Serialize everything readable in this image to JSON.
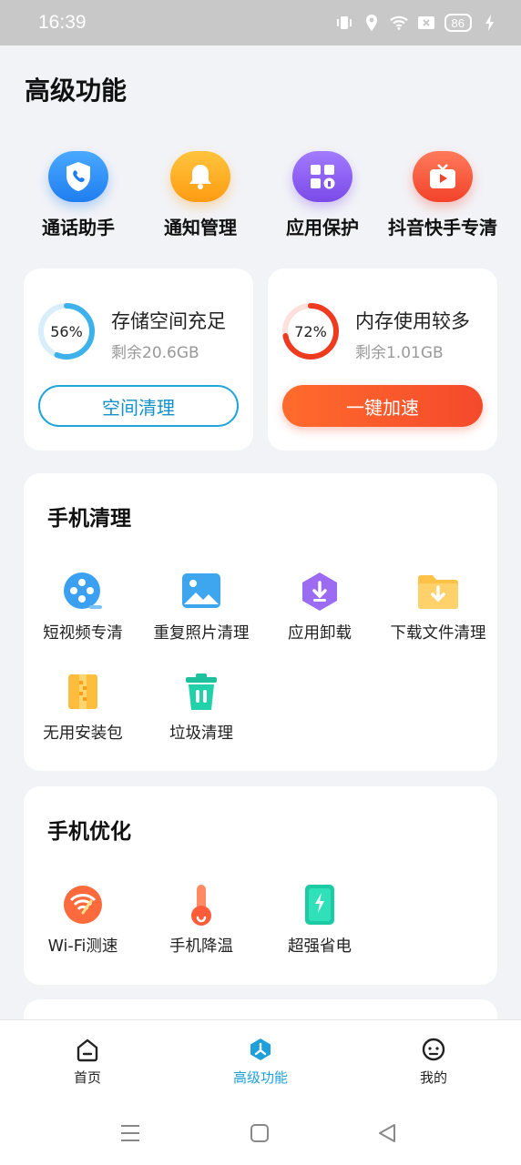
{
  "status": {
    "time": "16:39",
    "battery": "86"
  },
  "page": {
    "title": "高级功能"
  },
  "quick": [
    {
      "label": "通话助手",
      "icon": "phone-shield-icon",
      "color": "#2b8ff5"
    },
    {
      "label": "通知管理",
      "icon": "bell-icon",
      "color": "#ffae1f"
    },
    {
      "label": "应用保护",
      "icon": "apps-lock-icon",
      "color": "#8a5cf0"
    },
    {
      "label": "抖音快手专清",
      "icon": "video-play-icon",
      "color": "#f5553a"
    }
  ],
  "storage": {
    "percent": "56%",
    "percent_value": 56,
    "title": "存储空间充足",
    "sub": "剩余20.6GB",
    "button": "空间清理",
    "color": "#3cb1ea"
  },
  "memory": {
    "percent": "72%",
    "percent_value": 72,
    "title": "内存使用较多",
    "sub": "剩余1.01GB",
    "button": "一键加速",
    "color": "#ee3a1f"
  },
  "clean": {
    "title": "手机清理",
    "items": [
      {
        "label": "短视频专清",
        "icon": "short-video-icon"
      },
      {
        "label": "重复照片清理",
        "icon": "photo-icon"
      },
      {
        "label": "应用卸载",
        "icon": "uninstall-icon"
      },
      {
        "label": "下载文件清理",
        "icon": "download-folder-icon"
      },
      {
        "label": "无用安装包",
        "icon": "package-icon"
      },
      {
        "label": "垃圾清理",
        "icon": "trash-icon"
      }
    ]
  },
  "optimize": {
    "title": "手机优化",
    "items": [
      {
        "label": "Wi-Fi测速",
        "icon": "wifi-speed-icon"
      },
      {
        "label": "手机降温",
        "icon": "thermometer-icon"
      },
      {
        "label": "超强省电",
        "icon": "battery-saver-icon"
      }
    ]
  },
  "nav": {
    "home": "首页",
    "advanced": "高级功能",
    "mine": "我的"
  }
}
